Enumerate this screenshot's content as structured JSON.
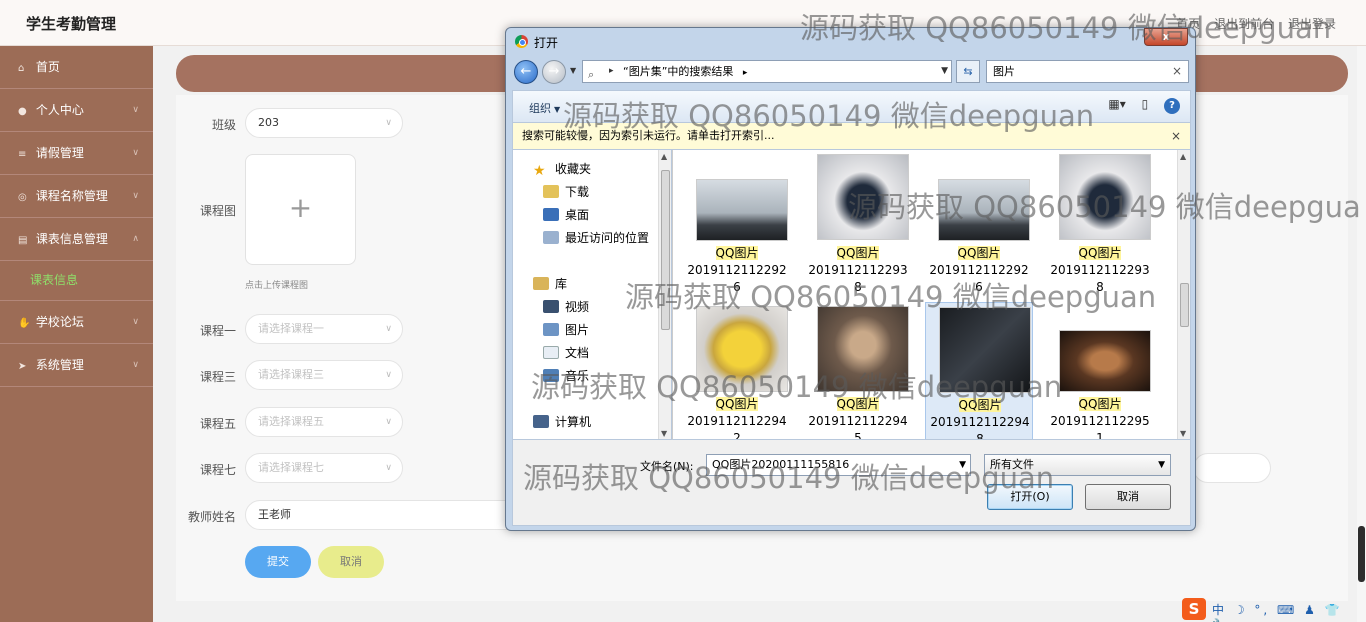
{
  "app": {
    "title": "学生考勤管理",
    "top_links": [
      "首页",
      "退出到前台",
      "退出登录"
    ]
  },
  "sidebar": {
    "items": [
      {
        "label": "首页",
        "icon": "home-icon"
      },
      {
        "label": "个人中心",
        "icon": "user-icon"
      },
      {
        "label": "请假管理",
        "icon": "list-icon"
      },
      {
        "label": "课程名称管理",
        "icon": "compass-icon"
      },
      {
        "label": "课表信息管理",
        "icon": "book-icon"
      },
      {
        "label": "课表信息",
        "icon": "",
        "sub": true
      },
      {
        "label": "学校论坛",
        "icon": "thumb-icon"
      },
      {
        "label": "系统管理",
        "icon": "send-icon"
      }
    ]
  },
  "form": {
    "class_label": "班级",
    "class_value": "203",
    "image_label": "课程图",
    "upload_hint": "点击上传课程图",
    "course1_label": "课程一",
    "course1_placeholder": "请选择课程一",
    "course3_label": "课程三",
    "course3_placeholder": "请选择课程三",
    "course5_label": "课程五",
    "course5_placeholder": "请选择课程五",
    "course7_label": "课程七",
    "course7_placeholder": "请选择课程七",
    "teacher_label": "教师姓名",
    "teacher_value": "王老师",
    "submit_label": "提交",
    "cancel_label": "取消"
  },
  "dialog": {
    "title": "打开",
    "close_symbol": "x",
    "address": "“图片集”中的搜索结果",
    "search_value": "图片",
    "organize_label": "组织",
    "info_text": "搜索可能较慢，因为索引未运行。请单击打开索引...",
    "nav_tree": [
      {
        "label": "收藏夹",
        "icon": "star-icon"
      },
      {
        "label": "下载",
        "icon": "download-folder-icon"
      },
      {
        "label": "桌面",
        "icon": "desktop-icon"
      },
      {
        "label": "最近访问的位置",
        "icon": "recent-places-icon"
      },
      {
        "label": "库",
        "icon": "library-icon"
      },
      {
        "label": "视频",
        "icon": "video-icon"
      },
      {
        "label": "图片",
        "icon": "pictures-icon"
      },
      {
        "label": "文档",
        "icon": "documents-icon"
      },
      {
        "label": "音乐",
        "icon": "music-icon"
      },
      {
        "label": "计算机",
        "icon": "computer-icon"
      }
    ],
    "files": [
      {
        "name_hl": "QQ图片",
        "name_line2": "2019112112292",
        "name_line3": "6",
        "thumb": "bird-silhouette"
      },
      {
        "name_hl": "QQ图片",
        "name_line2": "2019112112293",
        "name_line3": "8",
        "thumb": "panda"
      },
      {
        "name_hl": "QQ图片",
        "name_line2": "2019112112292",
        "name_line3": "6",
        "thumb": "bird-silhouette"
      },
      {
        "name_hl": "QQ图片",
        "name_line2": "2019112112293",
        "name_line3": "8",
        "thumb": "panda"
      },
      {
        "name_hl": "QQ图片",
        "name_line2": "2019112112294",
        "name_line3": "2",
        "thumb": "pikachu"
      },
      {
        "name_hl": "QQ图片",
        "name_line2": "2019112112294",
        "name_line3": "5",
        "thumb": "monkey"
      },
      {
        "name_hl": "QQ图片",
        "name_line2": "2019112112294",
        "name_line3": "8",
        "thumb": "dark-text"
      },
      {
        "name_hl": "QQ图片",
        "name_line2": "2019112112295",
        "name_line3": "1",
        "thumb": "crying-face"
      }
    ],
    "filename_label": "文件名(N):",
    "filename_value": "QQ图片20200111155816",
    "filetype_value": "所有文件",
    "open_label": "打开(O)",
    "cancel_label": "取消"
  },
  "watermarks": [
    "源码获取 QQ86050149 微信deepguan",
    "源码获取 QQ86050149 微信deepguan",
    "源码获取 QQ86050149 微信deepgua",
    "源码获取 QQ86050149 微信deepguan",
    "源码获取 QQ86050149 微信deepguan",
    "源码获取 QQ86050149 微信deepguan"
  ],
  "ime": {
    "logo": "S",
    "glyphs": "中 ☽ °, ⌨ ♟ 👕 🔧"
  }
}
